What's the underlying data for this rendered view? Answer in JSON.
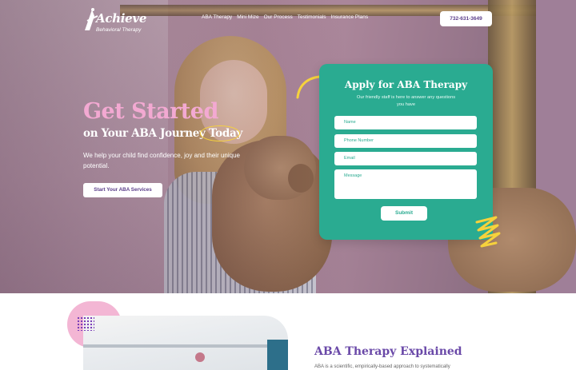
{
  "brand": {
    "name": "Achieve",
    "tagline": "Behavioral Therapy"
  },
  "nav": {
    "items": [
      "ABA Therapy",
      "Mini Mize",
      "Our Process",
      "Testimonials",
      "Insurance Plans"
    ],
    "phone": "732-631-3649"
  },
  "hero": {
    "headline": "Get Started",
    "subheadline_prefix": "on Your ABA Journey ",
    "subheadline_highlight": "Today",
    "description": "We help your child find confidence, joy and their unique potential.",
    "cta_label": "Start Your ABA Services"
  },
  "form": {
    "title": "Apply for ABA Therapy",
    "subtitle": "Our friendly staff is here to answer any questions you have",
    "fields": {
      "name_placeholder": "Name",
      "phone_placeholder": "Phone Number",
      "email_placeholder": "Email",
      "message_placeholder": "Message"
    },
    "submit_label": "Submit"
  },
  "section": {
    "title": "ABA Therapy Explained",
    "text": "ABA is a scientific, empirically-based approach to systematically"
  },
  "colors": {
    "accent_teal": "#2aab91",
    "headline_pink": "#f3a9d2",
    "brand_purple": "#6a49a8",
    "highlight_yellow": "#f6d23c"
  },
  "icons": [
    "logo-mark-icon",
    "curved-arrow-icon",
    "scribble-decoration-icon"
  ]
}
